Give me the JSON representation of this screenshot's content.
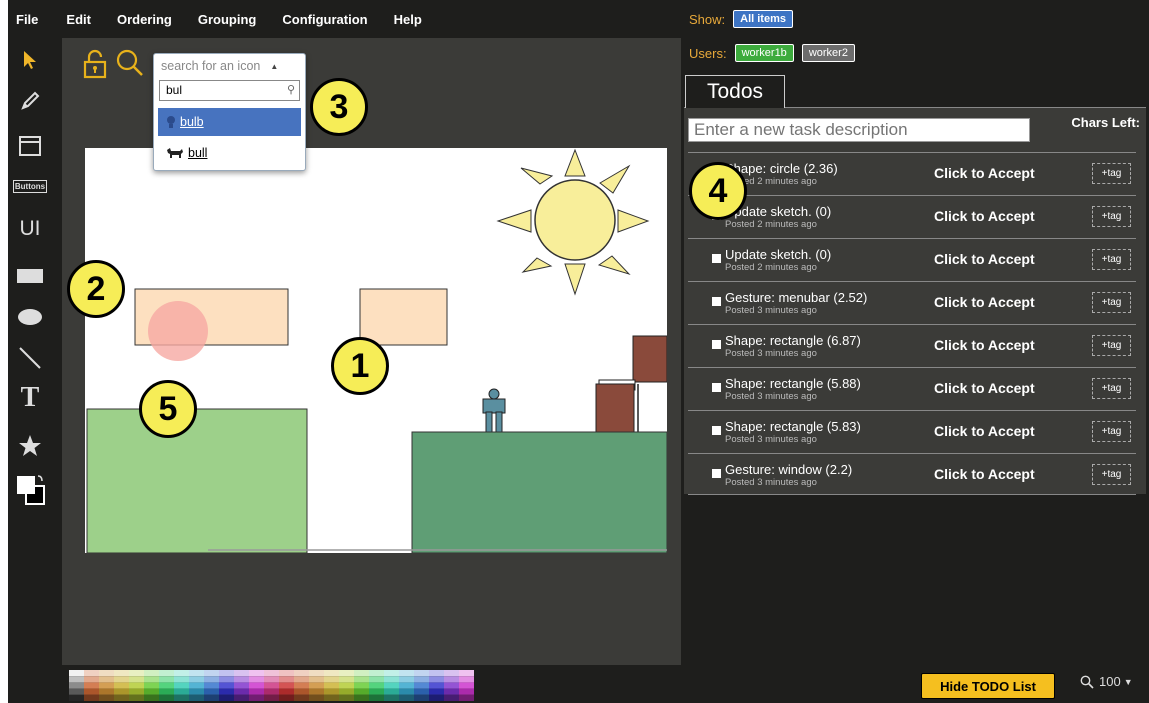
{
  "menu": [
    "File",
    "Edit",
    "Ordering",
    "Grouping",
    "Configuration",
    "Help"
  ],
  "toolbar": {
    "buttons_label": "Buttons",
    "ui_label": "UI",
    "text_label": "T"
  },
  "canvas_toolbar": {
    "icons": [
      "lock-icon",
      "search-icon"
    ]
  },
  "icon_search": {
    "placeholder": "search for an icon",
    "query": "bul",
    "results": [
      {
        "label": "bulb",
        "selected": true
      },
      {
        "label": "bull",
        "selected": false
      }
    ]
  },
  "callouts": [
    "1",
    "2",
    "3",
    "4",
    "5"
  ],
  "right_panel": {
    "show_label": "Show:",
    "show_filter": "All items",
    "users_label": "Users:",
    "users": [
      {
        "name": "worker1b",
        "color": "#3dab3d"
      },
      {
        "name": "worker2",
        "color": "#6c6c6c"
      }
    ],
    "tab": "Todos",
    "task_placeholder": "Enter a new task description",
    "chars_left": "Chars Left:",
    "tasks": [
      {
        "title": "Shape: circle (2.36)",
        "time": "Posted 2 minutes ago",
        "action": "Click to Accept",
        "tag": "+tag"
      },
      {
        "title": "Update sketch. (0)",
        "time": "Posted 2 minutes ago",
        "action": "Click to Accept",
        "tag": "+tag"
      },
      {
        "title": "Update sketch. (0)",
        "time": "Posted 2 minutes ago",
        "action": "Click to Accept",
        "tag": "+tag"
      },
      {
        "title": "Gesture: menubar (2.52)",
        "time": "Posted 3 minutes ago",
        "action": "Click to Accept",
        "tag": "+tag"
      },
      {
        "title": "Shape: rectangle (6.87)",
        "time": "Posted 3 minutes ago",
        "action": "Click to Accept",
        "tag": "+tag"
      },
      {
        "title": "Shape: rectangle (5.88)",
        "time": "Posted 3 minutes ago",
        "action": "Click to Accept",
        "tag": "+tag"
      },
      {
        "title": "Shape: rectangle (5.83)",
        "time": "Posted 3 minutes ago",
        "action": "Click to Accept",
        "tag": "+tag"
      },
      {
        "title": "Gesture: window (2.2)",
        "time": "Posted 3 minutes ago",
        "action": "Click to Accept",
        "tag": "+tag"
      }
    ]
  },
  "bottom": {
    "hide_button": "Hide TODO List",
    "zoom": "100"
  },
  "colors": {
    "accent_yellow": "#f5bf1f",
    "callout_fill": "#f6ed57",
    "selected_blue": "#4773bf"
  }
}
